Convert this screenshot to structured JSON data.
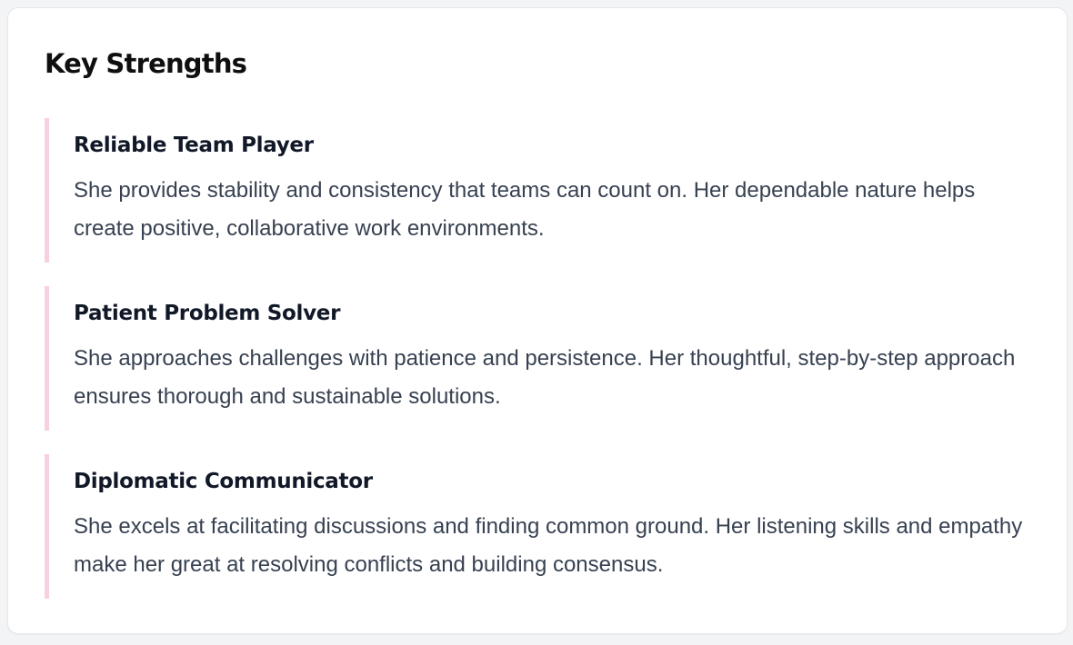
{
  "section": {
    "title": "Key Strengths",
    "items": [
      {
        "title": "Reliable Team Player",
        "text": "She provides stability and consistency that teams can count on. Her dependable nature helps create positive, collaborative work environments."
      },
      {
        "title": "Patient Problem Solver",
        "text": "She approaches challenges with patience and persistence. Her thoughtful, step-by-step approach ensures thorough and sustainable solutions."
      },
      {
        "title": "Diplomatic Communicator",
        "text": "She excels at facilitating discussions and finding common ground. Her listening skills and empathy make her great at resolving conflicts and building consensus."
      }
    ]
  },
  "colors": {
    "accent_border": "#f9cfe4",
    "title": "#0f0f10",
    "body_text": "#374151"
  }
}
